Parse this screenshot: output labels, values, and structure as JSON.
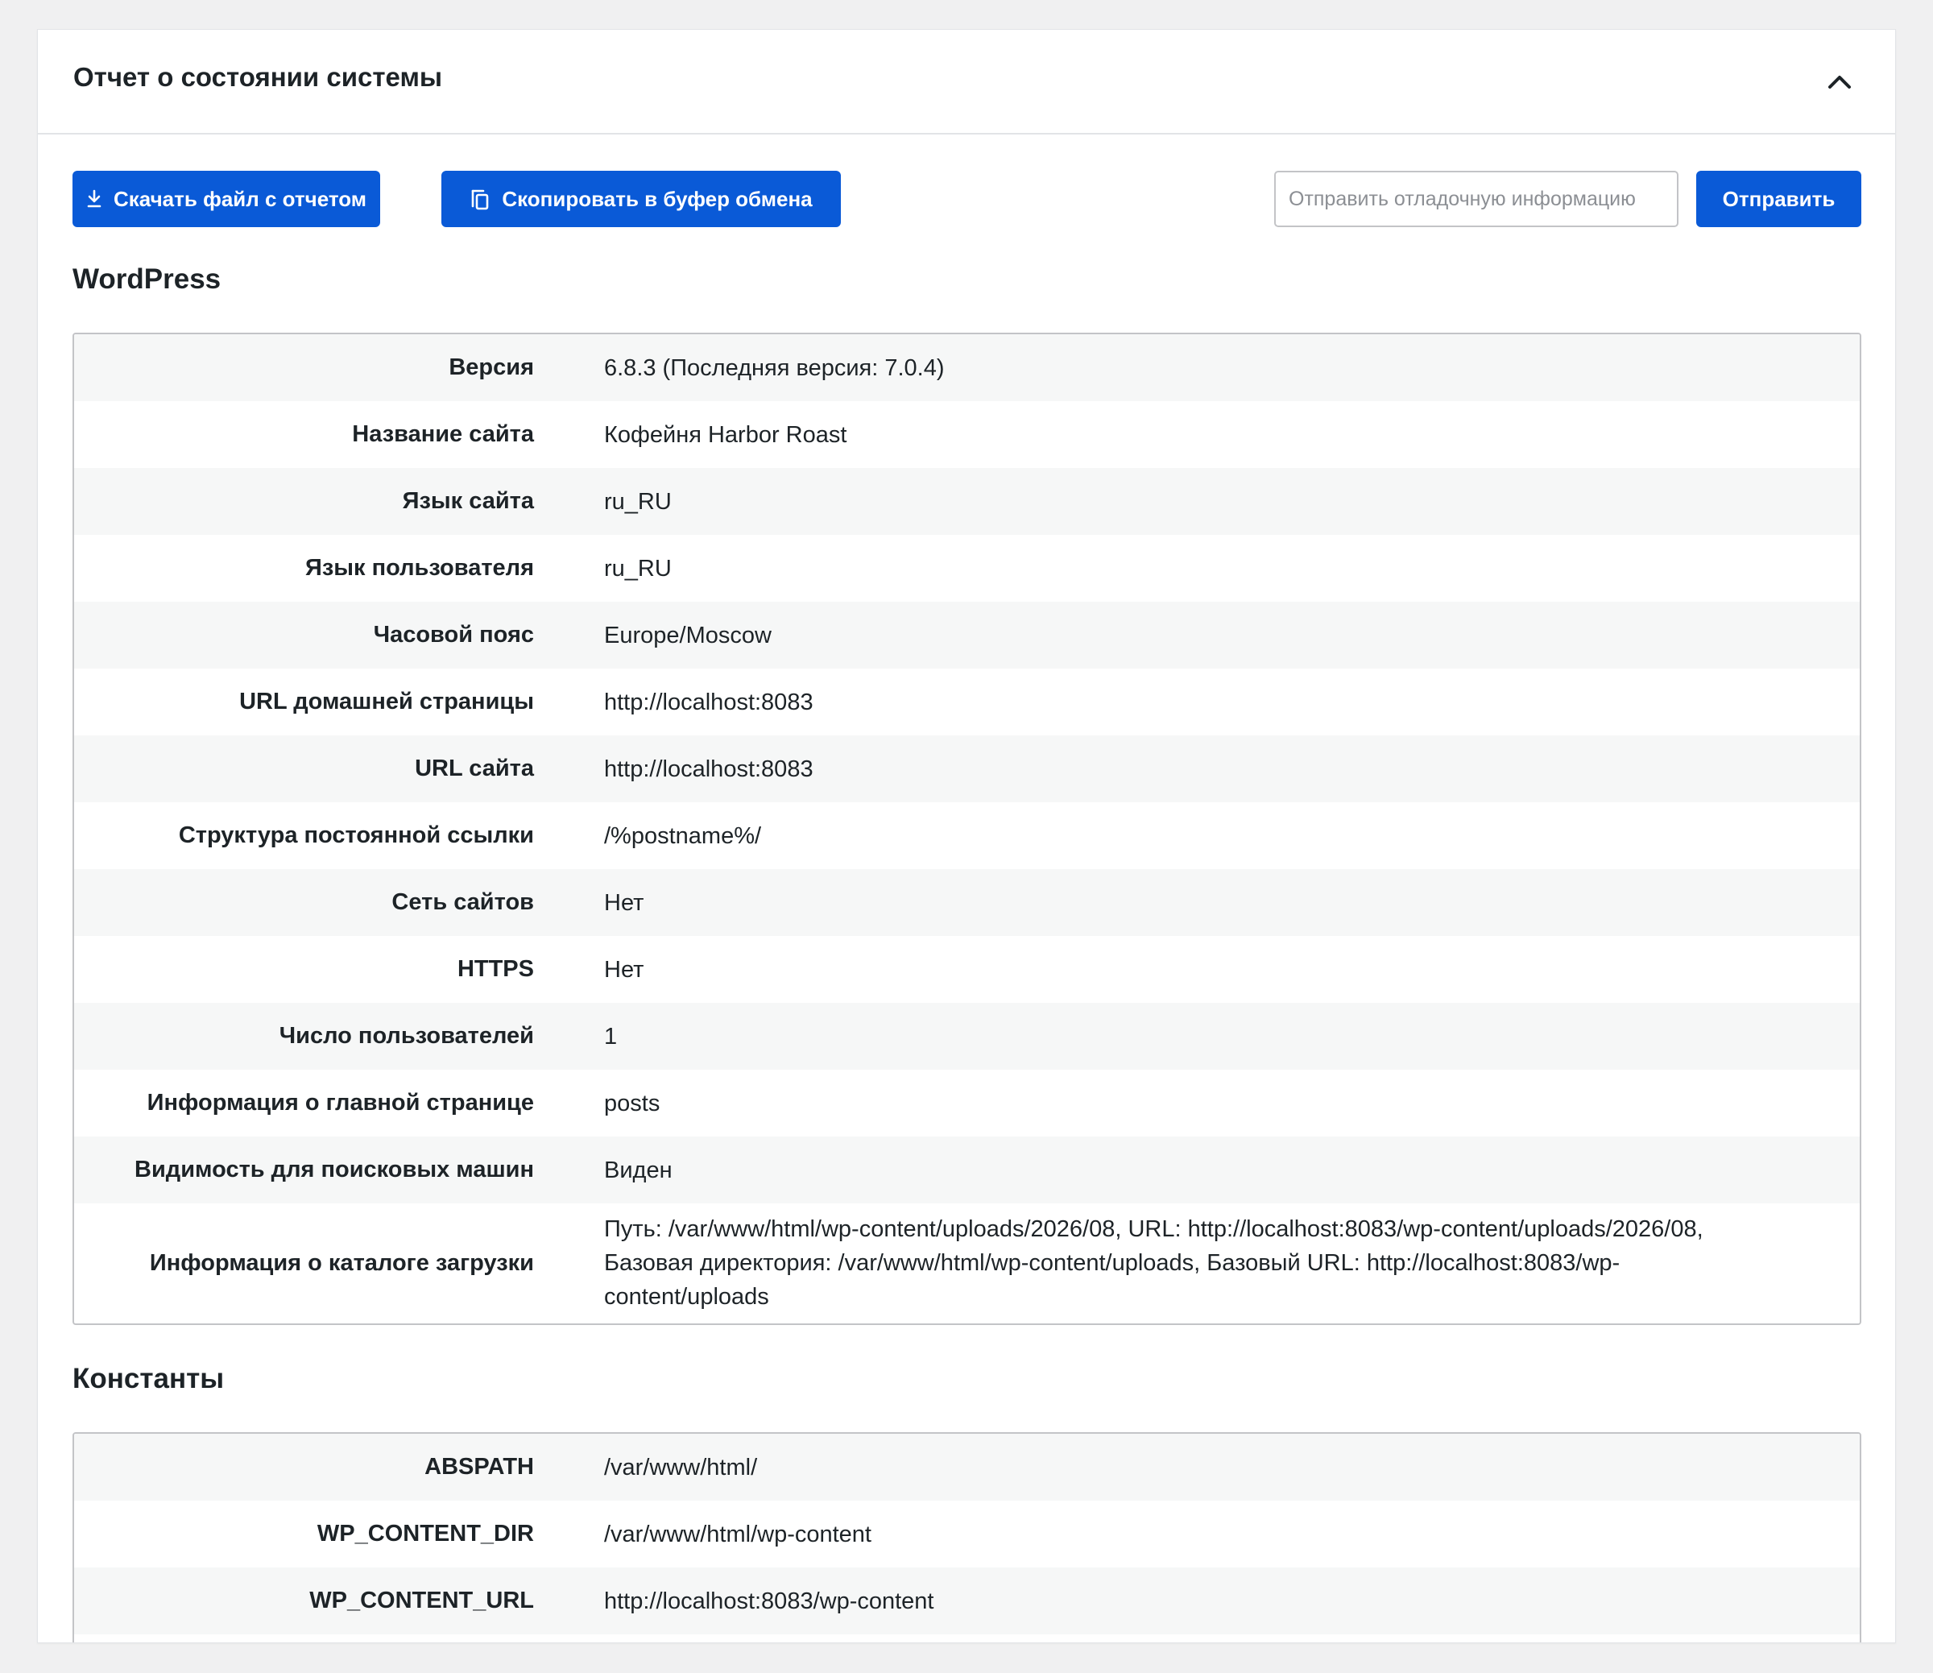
{
  "header": {
    "title": "Отчет о состоянии системы"
  },
  "toolbar": {
    "download_label": "Скачать файл с отчетом",
    "copy_label": "Скопировать в буфер обмена",
    "debug_placeholder": "Отправить отладочную информацию",
    "send_label": "Отправить"
  },
  "wordpress": {
    "title": "WordPress",
    "rows": [
      {
        "label": "Версия",
        "value": "6.8.3 (Последняя версия: 7.0.4)"
      },
      {
        "label": "Название сайта",
        "value": "Кофейня Harbor Roast"
      },
      {
        "label": "Язык сайта",
        "value": "ru_RU"
      },
      {
        "label": "Язык пользователя",
        "value": "ru_RU"
      },
      {
        "label": "Часовой пояс",
        "value": "Europe/Moscow"
      },
      {
        "label": "URL домашней страницы",
        "value": "http://localhost:8083"
      },
      {
        "label": "URL сайта",
        "value": "http://localhost:8083"
      },
      {
        "label": "Структура постоянной ссылки",
        "value": "/%postname%/"
      },
      {
        "label": "Сеть сайтов",
        "value": "Нет"
      },
      {
        "label": "HTTPS",
        "value": "Нет"
      },
      {
        "label": "Число пользователей",
        "value": "1"
      },
      {
        "label": "Информация о главной странице",
        "value": "posts"
      },
      {
        "label": "Видимость для поисковых машин",
        "value": "Виден"
      },
      {
        "label": "Информация о каталоге загрузки",
        "value": "Путь: /var/www/html/wp-content/uploads/2026/08, URL: http://localhost:8083/wp-content/uploads/2026/08, Базовая директория: /var/www/html/wp-content/uploads, Базовый URL: http://localhost:8083/wp-content/uploads"
      }
    ]
  },
  "constants": {
    "title": "Константы",
    "rows": [
      {
        "label": "ABSPATH",
        "value": "/var/www/html/"
      },
      {
        "label": "WP_CONTENT_DIR",
        "value": "/var/www/html/wp-content"
      },
      {
        "label": "WP_CONTENT_URL",
        "value": "http://localhost:8083/wp-content"
      },
      {
        "label": "",
        "value": ""
      }
    ]
  },
  "colors": {
    "primary_button": "#0a5ad7",
    "page_background": "#f0f0f1",
    "row_alt": "#f6f7f7"
  },
  "icons": {
    "collapse": "chevron-up-icon",
    "download": "download-icon",
    "copy": "copy-icon"
  }
}
